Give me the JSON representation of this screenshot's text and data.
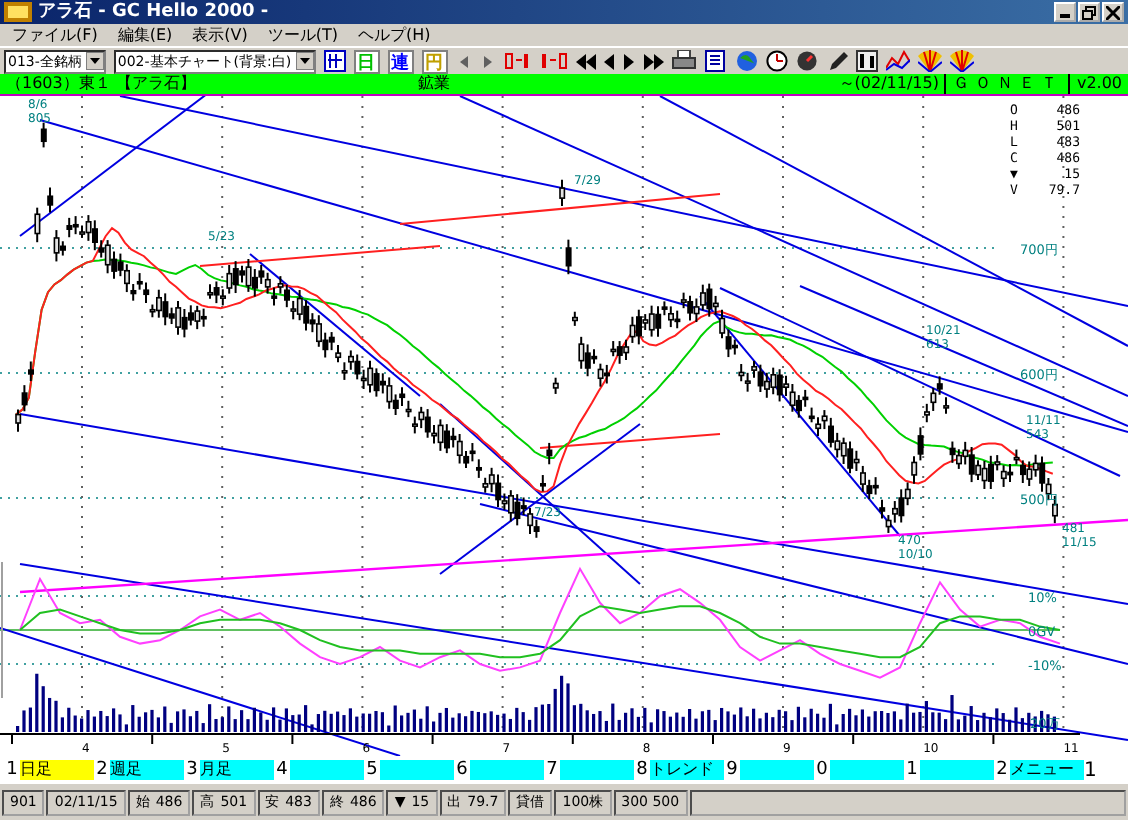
{
  "window": {
    "title": "アラ石 - GC Hello 2000 -"
  },
  "menu": [
    "ファイル(F)",
    "編集(E)",
    "表示(V)",
    "ツール(T)",
    "ヘルプ(H)"
  ],
  "toolbar": {
    "selects": [
      "013-全銘柄",
      "002-基本チャート(背景:白)"
    ],
    "char_buttons": [
      {
        "label": "日",
        "color": "#00c000"
      },
      {
        "label": "連",
        "color": "#0000ff"
      },
      {
        "label": "円",
        "color": "#c0a000"
      }
    ]
  },
  "info_bar": {
    "code": "（1603）東１ 【アラ石】",
    "sector": "鉱業",
    "date": "～(02/11/15)",
    "brand": "ＧＯＮＥＴ",
    "version": "v2.00"
  },
  "chart": {
    "price_labels": [
      "700円",
      "600円",
      "500円"
    ],
    "ohlc": [
      {
        "label": "O",
        "value": "486"
      },
      {
        "label": "H",
        "value": "501"
      },
      {
        "label": "L",
        "value": "483"
      },
      {
        "label": "C",
        "value": "486"
      },
      {
        "label": "▼",
        "value": "15"
      },
      {
        "label": "V",
        "value": "79.7"
      }
    ],
    "oscillator": {
      "chart_data": {
        "type": "line",
        "ylim": [
          -0.2,
          0.2
        ],
        "yticks": [
          {
            "value": 0.1,
            "label": "10%"
          },
          {
            "value": 0,
            "label": "0GV"
          },
          {
            "value": -0.1,
            "label": "-10%"
          }
        ],
        "series": [
          {
            "color": "#ff40ff",
            "values": [
              0.0,
              0.15,
              0.05,
              0.02,
              0.03,
              -0.02,
              -0.04,
              -0.03,
              0.0,
              0.04,
              0.06,
              0.03,
              0.05,
              0.01,
              -0.04,
              -0.08,
              -0.1,
              -0.08,
              -0.05,
              -0.09,
              -0.11,
              -0.08,
              -0.06,
              -0.1,
              -0.12,
              -0.11,
              -0.09,
              0.05,
              0.18,
              0.08,
              0.02,
              0.05,
              0.1,
              0.12,
              0.08,
              0.03,
              -0.05,
              -0.09,
              -0.06,
              -0.03,
              -0.07,
              -0.1,
              -0.12,
              -0.14,
              -0.11,
              0.02,
              0.14,
              0.06,
              0.01,
              0.03,
              0.02,
              -0.02,
              -0.04
            ]
          },
          {
            "color": "#20c020",
            "values": [
              0.0,
              0.05,
              0.06,
              0.04,
              0.02,
              0.0,
              -0.01,
              -0.01,
              0.0,
              0.02,
              0.03,
              0.03,
              0.03,
              0.02,
              0.0,
              -0.03,
              -0.05,
              -0.06,
              -0.06,
              -0.06,
              -0.07,
              -0.07,
              -0.07,
              -0.07,
              -0.08,
              -0.08,
              -0.07,
              -0.03,
              0.04,
              0.07,
              0.06,
              0.05,
              0.06,
              0.07,
              0.07,
              0.05,
              0.02,
              -0.02,
              -0.04,
              -0.04,
              -0.05,
              -0.06,
              -0.07,
              -0.08,
              -0.08,
              -0.05,
              0.02,
              0.04,
              0.04,
              0.03,
              0.03,
              0.01,
              0.0
            ]
          }
        ]
      }
    },
    "volume_label": "20万",
    "months": [
      "4",
      "5",
      "6",
      "7",
      "8",
      "9",
      "10",
      "11"
    ],
    "annotations": [
      {
        "lines": [
          "8/6",
          "805"
        ]
      },
      {
        "lines": [
          "5/23"
        ]
      },
      {
        "lines": [
          "7/29"
        ]
      },
      {
        "lines": [
          "10/21",
          "613"
        ]
      },
      {
        "lines": [
          "11/11",
          "543"
        ]
      },
      {
        "lines": [
          "470",
          "10/10"
        ]
      },
      {
        "lines": [
          "481",
          "11/15"
        ]
      },
      {
        "lines": [
          "7/23"
        ]
      }
    ]
  },
  "function_keys": [
    {
      "key": "1",
      "label": "日足",
      "selected": true
    },
    {
      "key": "2",
      "label": "週足",
      "selected": false
    },
    {
      "key": "3",
      "label": "月足",
      "selected": false
    },
    {
      "key": "4",
      "selected": false
    },
    {
      "key": "5",
      "selected": false
    },
    {
      "key": "6",
      "selected": false
    },
    {
      "key": "7",
      "selected": false
    },
    {
      "key": "8",
      "label": "トレンド",
      "selected": false
    },
    {
      "key": "9",
      "selected": false
    },
    {
      "key": "0",
      "selected": false
    },
    {
      "key": "1",
      "selected": false
    },
    {
      "key": "2",
      "label": "メニュー",
      "selected": false
    }
  ],
  "page_indicator": "1",
  "status_bar": [
    {
      "value": "901"
    },
    {
      "value": "02/11/15"
    },
    {
      "label": "始",
      "value": "486"
    },
    {
      "label": "高",
      "value": "501"
    },
    {
      "label": "安",
      "value": "483"
    },
    {
      "label": "終",
      "value": "486"
    },
    {
      "label": "▼",
      "value": "15"
    },
    {
      "label": "出",
      "value": "79.7"
    },
    {
      "value": "貸借"
    },
    {
      "value": "100株"
    },
    {
      "value": "300 500"
    }
  ]
}
